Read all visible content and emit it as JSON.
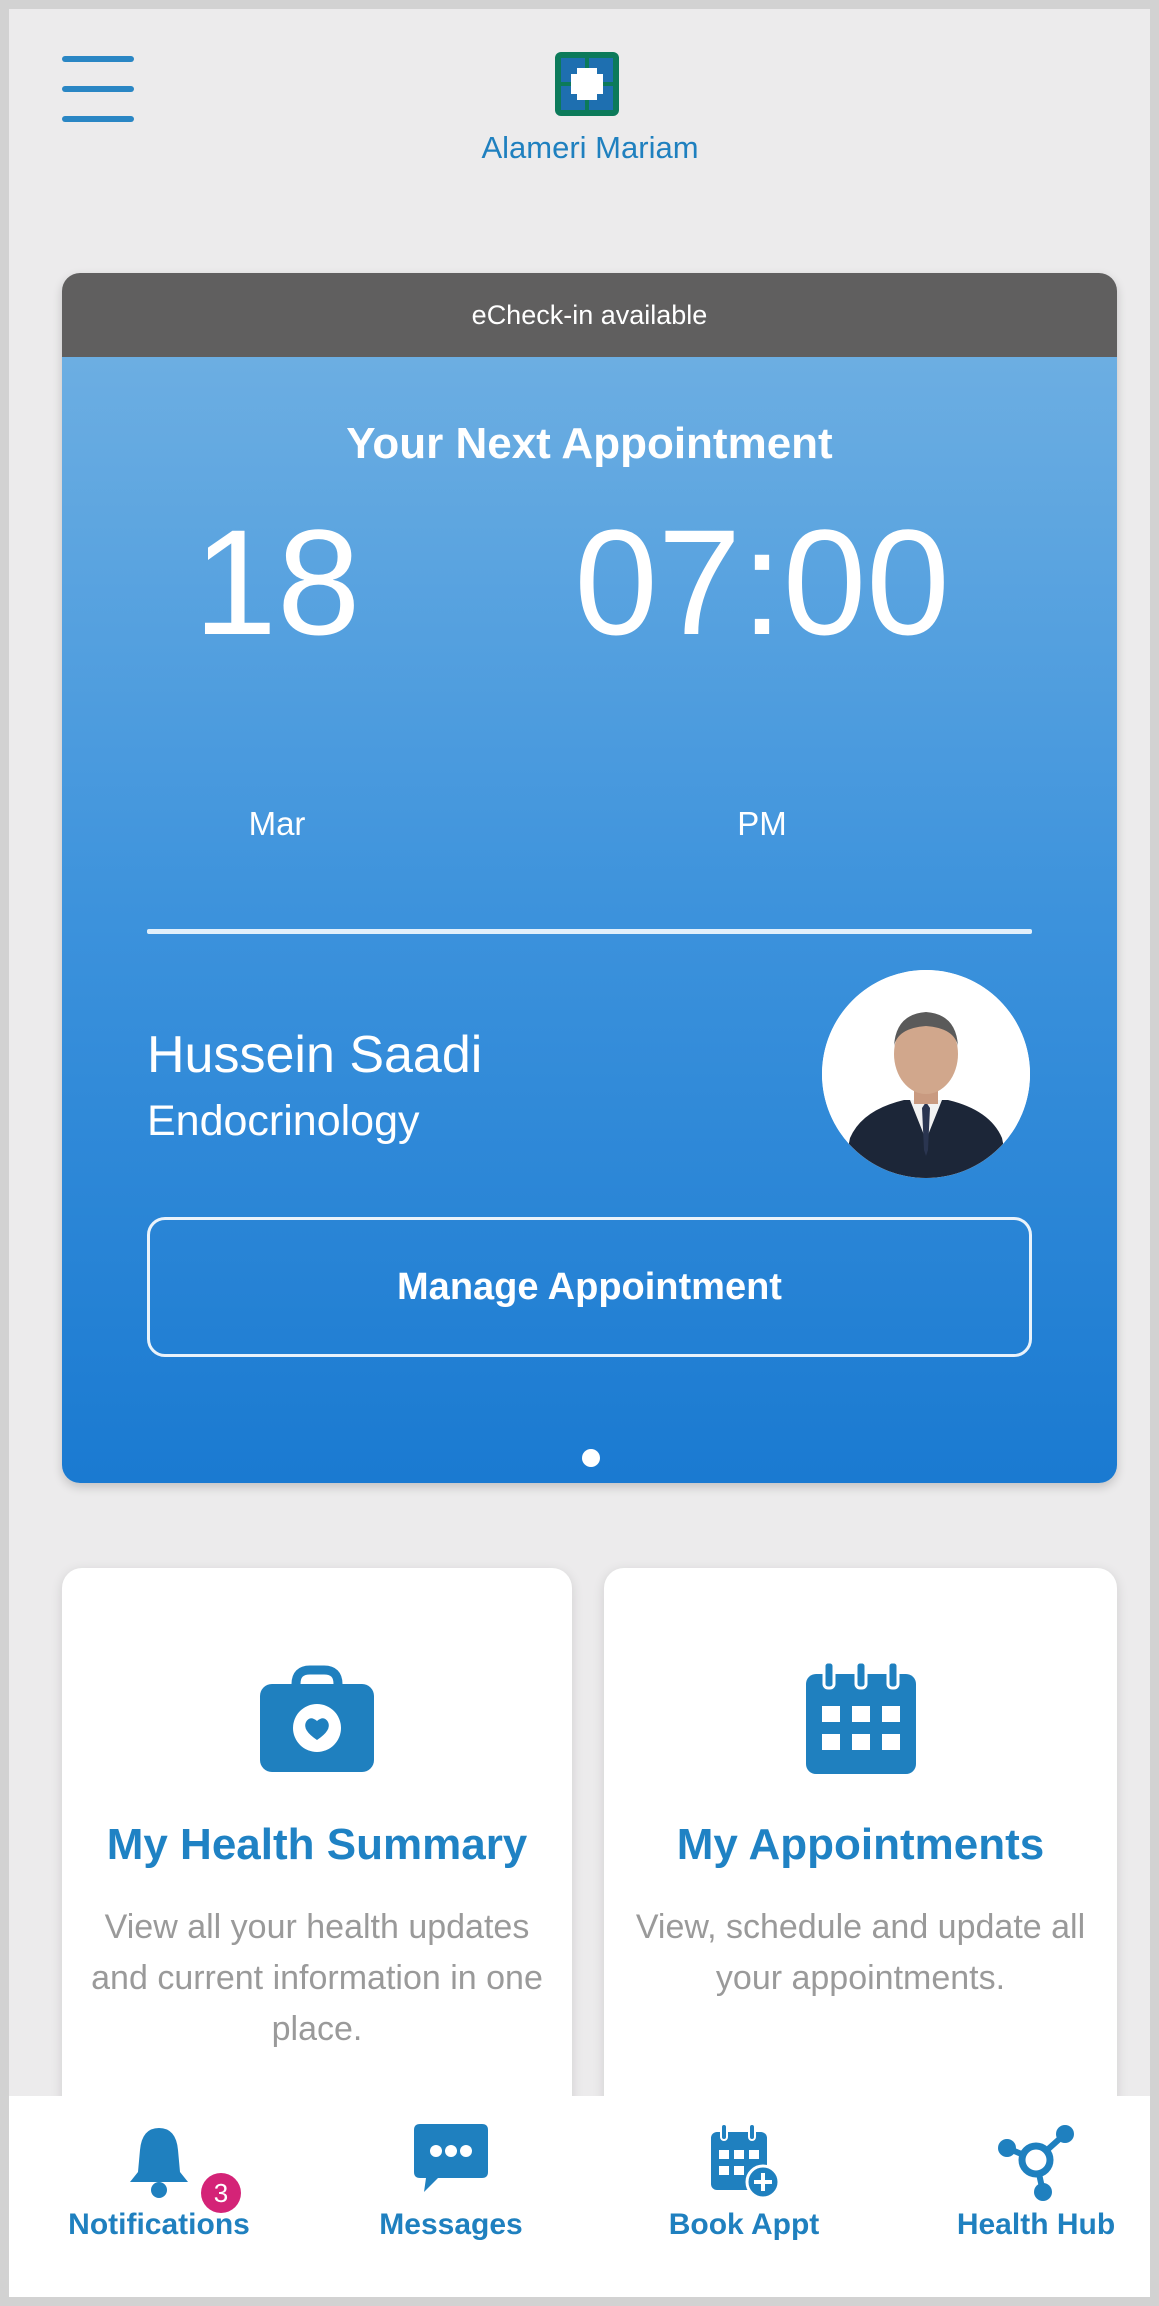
{
  "header": {
    "profile_name": "Alameri Mariam",
    "menu_icon": "hamburger-menu-icon",
    "logo": "clinic-logo-icon"
  },
  "appointment": {
    "echeckin_text": "eCheck-in available",
    "title": "Your Next Appointment",
    "day": "18",
    "month": "Mar",
    "time": "07:00",
    "ampm": "PM",
    "doctor_name": "Hussein Saadi",
    "specialty": "Endocrinology",
    "manage_label": "Manage Appointment",
    "page_count": 1,
    "current_page": 1
  },
  "tiles": [
    {
      "title": "My Health Summary",
      "description": "View all your health updates and current information in one place.",
      "icon": "health-briefcase-icon"
    },
    {
      "title": "My Appointments",
      "description": "View, schedule and update all your appointments.",
      "icon": "calendar-icon"
    }
  ],
  "bottom_nav": [
    {
      "label": "Notifications",
      "icon": "bell-icon",
      "badge": "3"
    },
    {
      "label": "Messages",
      "icon": "chat-bubble-icon"
    },
    {
      "label": "Book Appt",
      "icon": "calendar-add-icon"
    },
    {
      "label": "Health Hub",
      "icon": "hub-network-icon"
    }
  ],
  "colors": {
    "brand_blue": "#1f80bf",
    "card_top": "#6caee2",
    "card_bottom": "#1a7ad1",
    "checkin_bar": "#605f5f",
    "badge": "#d42377",
    "logo_green": "#0c7a5a"
  }
}
